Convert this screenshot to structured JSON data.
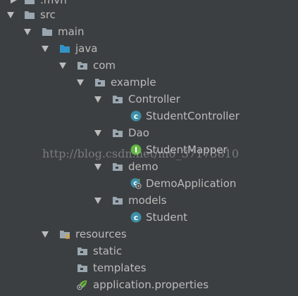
{
  "tree": {
    "items": [
      {
        "label": ".mvn"
      },
      {
        "label": "src"
      },
      {
        "label": "main"
      },
      {
        "label": "java"
      },
      {
        "label": "com"
      },
      {
        "label": "example"
      },
      {
        "label": "Controller"
      },
      {
        "label": "StudentController"
      },
      {
        "label": "Dao"
      },
      {
        "label": "StudentMapper"
      },
      {
        "label": "demo"
      },
      {
        "label": "DemoApplication"
      },
      {
        "label": "models"
      },
      {
        "label": "Student"
      },
      {
        "label": "resources"
      },
      {
        "label": "static"
      },
      {
        "label": "templates"
      },
      {
        "label": "application.properties"
      }
    ]
  },
  "watermark": "http://blog.csdn.net/m0_37173810",
  "colors": {
    "background": "#3c3f41",
    "text": "#bbbbbb",
    "folder": "#9aa7b0",
    "source_folder": "#3592c4",
    "class_icon": "#3d8fa8",
    "interface_icon": "#62b543",
    "spring_leaf": "#6db33f"
  }
}
